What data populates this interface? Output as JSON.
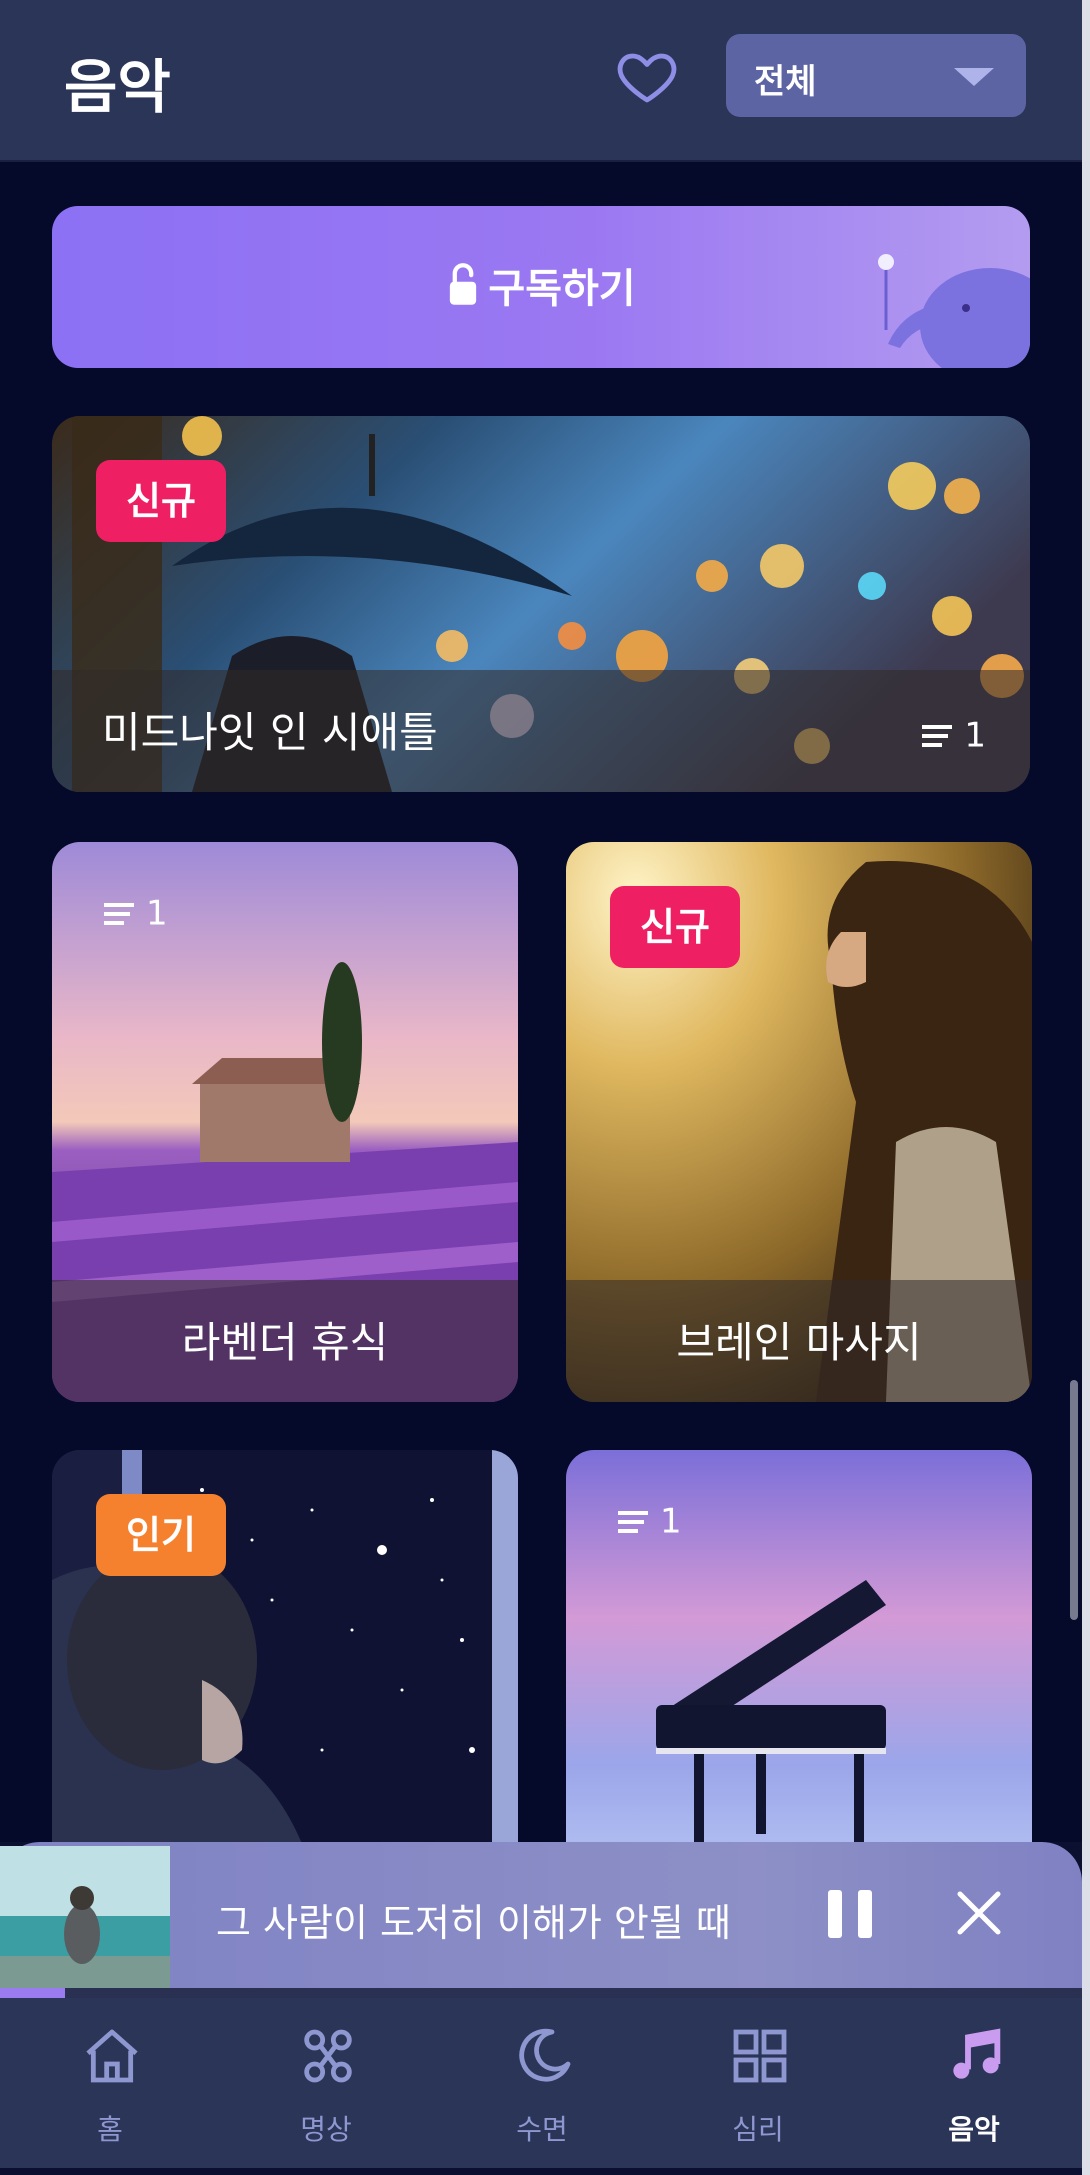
{
  "header": {
    "title": "음악",
    "filter": {
      "selected": "전체"
    }
  },
  "subscribe": {
    "label": "구독하기"
  },
  "cards": [
    {
      "title": "미드나잇 인 시애틀",
      "badge": "신규",
      "count": "1"
    },
    {
      "title": "라벤더 휴식",
      "count": "1"
    },
    {
      "title": "브레인 마사지",
      "badge": "신규"
    },
    {
      "title": "",
      "badge": "인기"
    },
    {
      "title": "",
      "count": "1"
    }
  ],
  "player": {
    "title": "그 사람이 도저히 이해가 안될 때",
    "progress": 0.06
  },
  "tabs": [
    {
      "label": "홈",
      "icon": "home-icon"
    },
    {
      "label": "명상",
      "icon": "meditation-icon"
    },
    {
      "label": "수면",
      "icon": "moon-icon"
    },
    {
      "label": "심리",
      "icon": "grid-icon"
    },
    {
      "label": "음악",
      "icon": "music-note-icon",
      "active": true
    }
  ],
  "colors": {
    "accent": "#9b78f2",
    "badge_new": "#ee1f63",
    "badge_hot": "#f5812e",
    "background": "#050a2b",
    "tab_inactive": "#8e97cf"
  }
}
